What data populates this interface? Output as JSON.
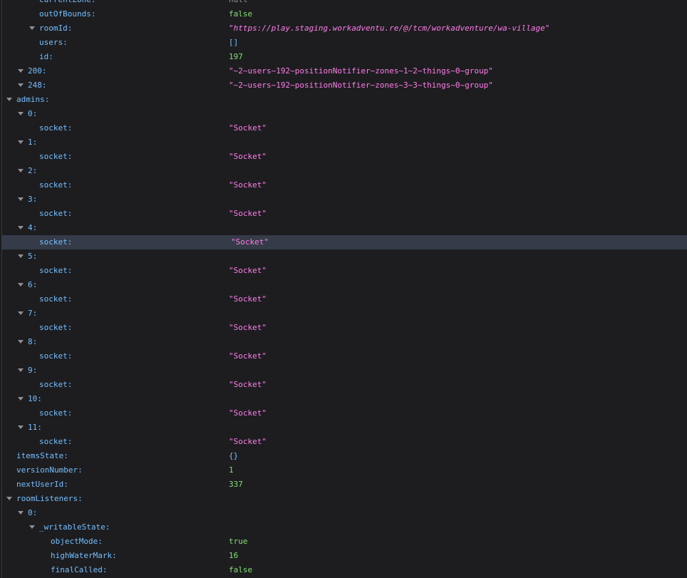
{
  "rows": [
    {
      "key": "currentZone:",
      "depth": 3,
      "expanded": false,
      "value": "null",
      "type": "null"
    },
    {
      "key": "outOfBounds:",
      "depth": 3,
      "expanded": false,
      "value": "false",
      "type": "bool"
    },
    {
      "key": "roomId:",
      "depth": 3,
      "expanded": true,
      "value": "https://play.staging.workadventu.re/@/tcm/workadventure/wa-village",
      "type": "url"
    },
    {
      "key": "users:",
      "depth": 3,
      "expanded": false,
      "value": "[]",
      "type": "empty"
    },
    {
      "key": "id:",
      "depth": 3,
      "expanded": false,
      "value": "197",
      "type": "num"
    },
    {
      "key": "200:",
      "depth": 2,
      "expanded": true,
      "value": "\"~2~users~192~positionNotifier~zones~1~2~things~0~group\"",
      "type": "string"
    },
    {
      "key": "248:",
      "depth": 2,
      "expanded": true,
      "value": "\"~2~users~192~positionNotifier~zones~3~3~things~0~group\"",
      "type": "string"
    },
    {
      "key": "admins:",
      "depth": 1,
      "expanded": true,
      "value": "",
      "type": "none"
    },
    {
      "key": "0:",
      "depth": 2,
      "expanded": true,
      "value": "",
      "type": "none"
    },
    {
      "key": "socket:",
      "depth": 3,
      "expanded": false,
      "value": "\"Socket\"",
      "type": "string"
    },
    {
      "key": "1:",
      "depth": 2,
      "expanded": true,
      "value": "",
      "type": "none"
    },
    {
      "key": "socket:",
      "depth": 3,
      "expanded": false,
      "value": "\"Socket\"",
      "type": "string"
    },
    {
      "key": "2:",
      "depth": 2,
      "expanded": true,
      "value": "",
      "type": "none"
    },
    {
      "key": "socket:",
      "depth": 3,
      "expanded": false,
      "value": "\"Socket\"",
      "type": "string"
    },
    {
      "key": "3:",
      "depth": 2,
      "expanded": true,
      "value": "",
      "type": "none"
    },
    {
      "key": "socket:",
      "depth": 3,
      "expanded": false,
      "value": "\"Socket\"",
      "type": "string"
    },
    {
      "key": "4:",
      "depth": 2,
      "expanded": true,
      "value": "",
      "type": "none"
    },
    {
      "key": "socket:",
      "depth": 3,
      "expanded": false,
      "value": "\"Socket\"",
      "type": "string",
      "selected": true
    },
    {
      "key": "5:",
      "depth": 2,
      "expanded": true,
      "value": "",
      "type": "none"
    },
    {
      "key": "socket:",
      "depth": 3,
      "expanded": false,
      "value": "\"Socket\"",
      "type": "string"
    },
    {
      "key": "6:",
      "depth": 2,
      "expanded": true,
      "value": "",
      "type": "none"
    },
    {
      "key": "socket:",
      "depth": 3,
      "expanded": false,
      "value": "\"Socket\"",
      "type": "string"
    },
    {
      "key": "7:",
      "depth": 2,
      "expanded": true,
      "value": "",
      "type": "none"
    },
    {
      "key": "socket:",
      "depth": 3,
      "expanded": false,
      "value": "\"Socket\"",
      "type": "string"
    },
    {
      "key": "8:",
      "depth": 2,
      "expanded": true,
      "value": "",
      "type": "none"
    },
    {
      "key": "socket:",
      "depth": 3,
      "expanded": false,
      "value": "\"Socket\"",
      "type": "string"
    },
    {
      "key": "9:",
      "depth": 2,
      "expanded": true,
      "value": "",
      "type": "none"
    },
    {
      "key": "socket:",
      "depth": 3,
      "expanded": false,
      "value": "\"Socket\"",
      "type": "string"
    },
    {
      "key": "10:",
      "depth": 2,
      "expanded": true,
      "value": "",
      "type": "none"
    },
    {
      "key": "socket:",
      "depth": 3,
      "expanded": false,
      "value": "\"Socket\"",
      "type": "string"
    },
    {
      "key": "11:",
      "depth": 2,
      "expanded": true,
      "value": "",
      "type": "none"
    },
    {
      "key": "socket:",
      "depth": 3,
      "expanded": false,
      "value": "\"Socket\"",
      "type": "string"
    },
    {
      "key": "itemsState:",
      "depth": 1,
      "expanded": false,
      "value": "{}",
      "type": "empty"
    },
    {
      "key": "versionNumber:",
      "depth": 1,
      "expanded": false,
      "value": "1",
      "type": "num"
    },
    {
      "key": "nextUserId:",
      "depth": 1,
      "expanded": false,
      "value": "337",
      "type": "num"
    },
    {
      "key": "roomListeners:",
      "depth": 1,
      "expanded": true,
      "value": "",
      "type": "none"
    },
    {
      "key": "0:",
      "depth": 2,
      "expanded": true,
      "value": "",
      "type": "none"
    },
    {
      "key": "_writableState:",
      "depth": 3,
      "expanded": true,
      "value": "",
      "type": "none"
    },
    {
      "key": "objectMode:",
      "depth": 4,
      "expanded": false,
      "value": "true",
      "type": "bool"
    },
    {
      "key": "highWaterMark:",
      "depth": 4,
      "expanded": false,
      "value": "16",
      "type": "num"
    },
    {
      "key": "finalCalled:",
      "depth": 4,
      "expanded": false,
      "value": "false",
      "type": "bool"
    }
  ]
}
